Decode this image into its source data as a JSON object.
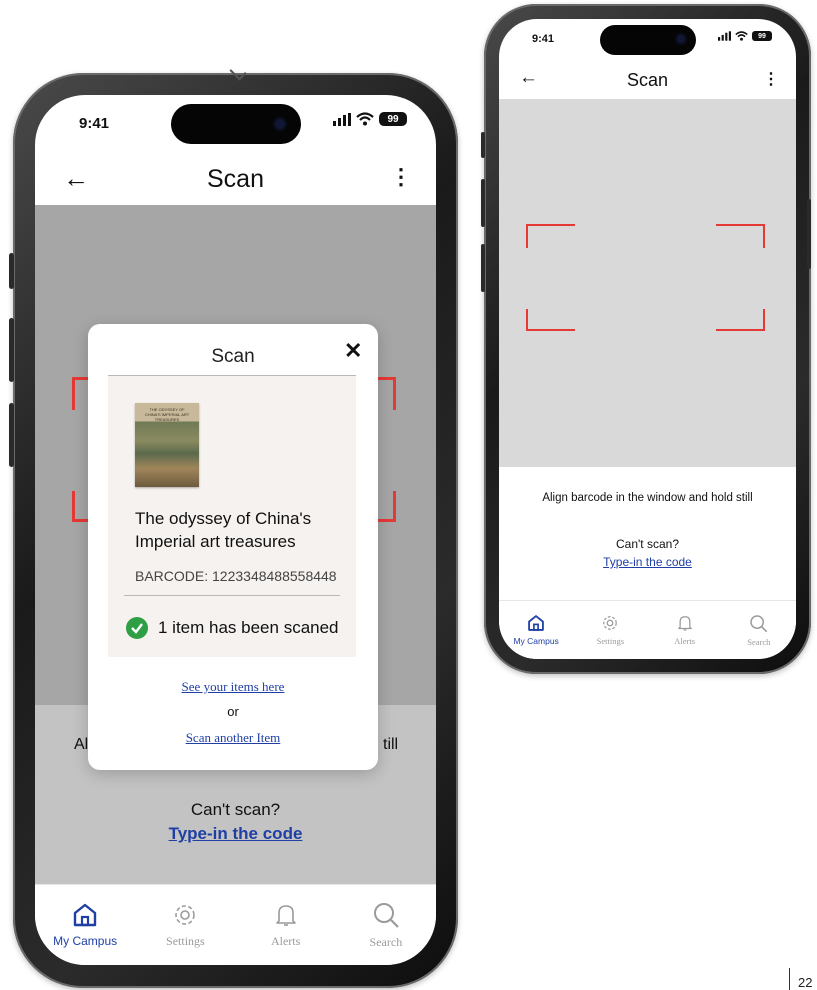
{
  "status_bar": {
    "time": "9:41",
    "battery": "99"
  },
  "large_phone": {
    "header": {
      "title": "Scan"
    },
    "instruction_left": "Al",
    "instruction_right": "till",
    "cant_scan": "Can't scan?",
    "type_in_code": "Type-in the code",
    "modal": {
      "title": "Scan",
      "book_title_line1": "The odyssey of China's",
      "book_title_line2": "Imperial art treasures",
      "barcode": "BARCODE: 1223348488558448",
      "status": "1 item has been scaned",
      "see_items": "See your items here",
      "or": "or",
      "scan_another": "Scan another Item",
      "cover_text": "THE ODYSSEY OF CHINA'S IMPERIAL ART TREASURES"
    }
  },
  "small_phone": {
    "header": {
      "title": "Scan"
    },
    "instruction": "Align barcode in the window and hold still",
    "cant_scan": "Can't scan?",
    "type_in_code": "Type-in the code"
  },
  "tabs": [
    {
      "label": "My Campus",
      "icon": "home-icon",
      "active": true
    },
    {
      "label": "Settings",
      "icon": "gear-icon",
      "active": false
    },
    {
      "label": "Alerts",
      "icon": "bell-icon",
      "active": false
    },
    {
      "label": "Search",
      "icon": "search-icon",
      "active": false
    }
  ],
  "page_number": "22",
  "colors": {
    "accent": "#1f3fa5",
    "scan_corner": "#e53935",
    "success": "#2e9f45"
  }
}
